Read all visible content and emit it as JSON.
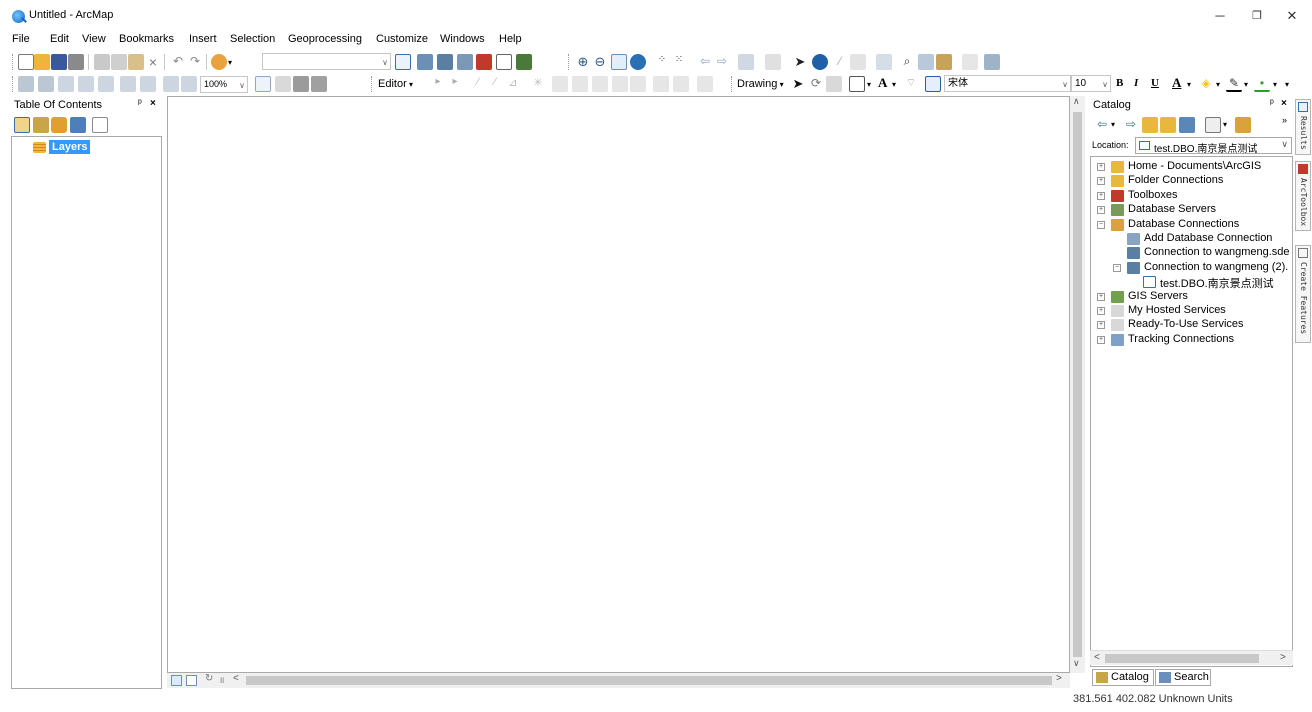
{
  "window": {
    "title": "Untitled - ArcMap"
  },
  "menu": [
    "File",
    "Edit",
    "View",
    "Bookmarks",
    "Insert",
    "Selection",
    "Geoprocessing",
    "Customize",
    "Windows",
    "Help"
  ],
  "toolbar": {
    "scale_value": "",
    "zoom_value": "100%",
    "editor_label": "Editor",
    "drawing_label": "Drawing",
    "font_name": "宋体",
    "font_size": "10",
    "bold_label": "B",
    "italic_label": "I",
    "underline_label": "U",
    "font_color_label": "A",
    "draw_text_label": "A"
  },
  "toc": {
    "title": "Table Of Contents",
    "pin": "ᵖ",
    "close": "×",
    "root_layer": "Layers"
  },
  "map": {
    "refresh_glyph": "↻",
    "pause_glyph": "॥"
  },
  "catalog": {
    "title": "Catalog",
    "location_label": "Location:",
    "location_value": "test.DBO.南京景点测试",
    "tree": [
      {
        "label": "Home - Documents\\ArcGIS",
        "icon": "folder-home-icon",
        "expander": "+"
      },
      {
        "label": "Folder Connections",
        "icon": "folder-icon",
        "expander": "+"
      },
      {
        "label": "Toolboxes",
        "icon": "toolbox-icon",
        "expander": "+"
      },
      {
        "label": "Database Servers",
        "icon": "database-server-icon",
        "expander": "+"
      },
      {
        "label": "Database Connections",
        "icon": "database-connections-icon",
        "expander": "−"
      },
      {
        "label": "Add Database Connection",
        "icon": "add-connection-icon",
        "expander": ""
      },
      {
        "label": "Connection to wangmeng.sde",
        "icon": "sde-connection-icon",
        "expander": ""
      },
      {
        "label": "Connection to wangmeng (2).",
        "icon": "sde-connection-icon",
        "expander": "−"
      },
      {
        "label": "test.DBO.南京景点测试",
        "icon": "feature-class-icon",
        "expander": ""
      },
      {
        "label": "GIS Servers",
        "icon": "gis-server-icon",
        "expander": "+"
      },
      {
        "label": "My Hosted Services",
        "icon": "hosted-services-icon",
        "expander": "+"
      },
      {
        "label": "Ready-To-Use Services",
        "icon": "ready-services-icon",
        "expander": "+"
      },
      {
        "label": "Tracking Connections",
        "icon": "tracking-icon",
        "expander": "+"
      }
    ],
    "tabs": [
      {
        "label": "Catalog",
        "icon": "catalog-icon"
      },
      {
        "label": "Search",
        "icon": "search-icon"
      }
    ]
  },
  "dock_tabs": [
    {
      "label": "Results",
      "icon": "results-icon"
    },
    {
      "label": "ArcToolbox",
      "icon": "arctoolbox-icon"
    },
    {
      "label": "Create Features",
      "icon": "create-features-icon"
    }
  ],
  "status": {
    "coordinates": "381.561  402.082 Unknown Units"
  },
  "colors": {
    "selection": "#3399ff",
    "accent_blue": "#1565c0",
    "folder_yellow": "#f2b443",
    "toolbox_red": "#c0392b"
  }
}
